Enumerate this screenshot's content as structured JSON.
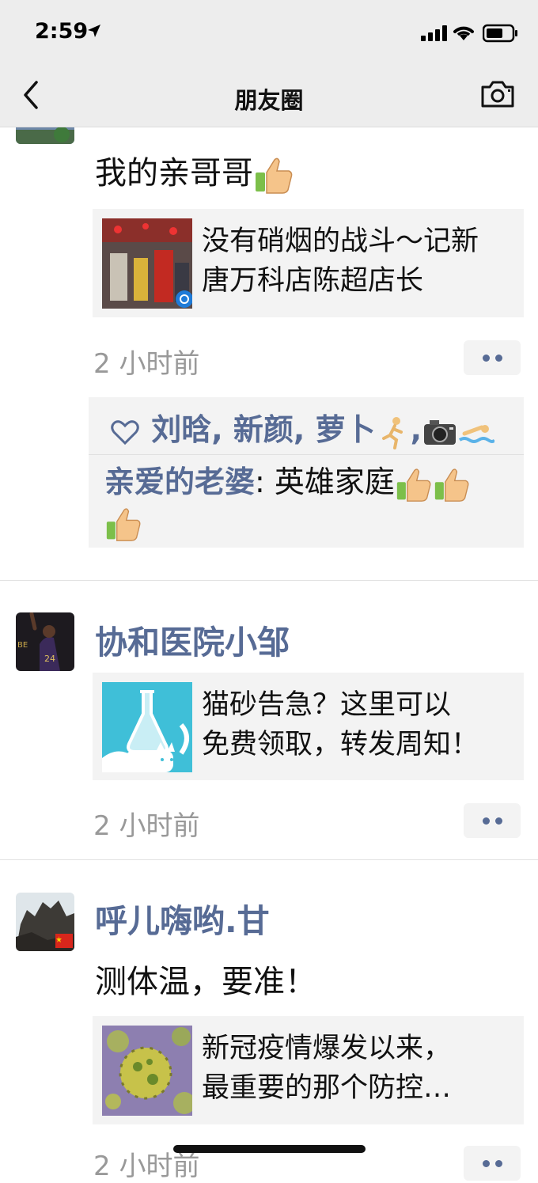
{
  "status_bar": {
    "time": "2:59"
  },
  "nav": {
    "title": "朋友圈"
  },
  "posts": [
    {
      "text": "我的亲哥哥",
      "link": {
        "line1": "没有硝烟的战斗～记新",
        "line2": "唐万科店陈超店长"
      },
      "time": "2 小时前",
      "likes": "刘晗, 新颜, 萝卜",
      "comment": {
        "author": "亲爱的老婆",
        "separator": ":",
        "text": "英雄家庭"
      }
    },
    {
      "name": "协和医院小邹",
      "link": {
        "line1": "猫砂告急？这里可以",
        "line2": "免费领取，转发周知！"
      },
      "time": "2 小时前"
    },
    {
      "name": "呼儿嗨哟.甘",
      "text": "测体温，要准！",
      "link": {
        "line1": "新冠疫情爆发以来，",
        "line2": "最重要的那个防控…"
      },
      "time": "2 小时前"
    }
  ],
  "colors": {
    "name": "#576b95",
    "time": "#999999",
    "card_bg": "#f3f3f3",
    "nav_bg": "#ededed"
  }
}
